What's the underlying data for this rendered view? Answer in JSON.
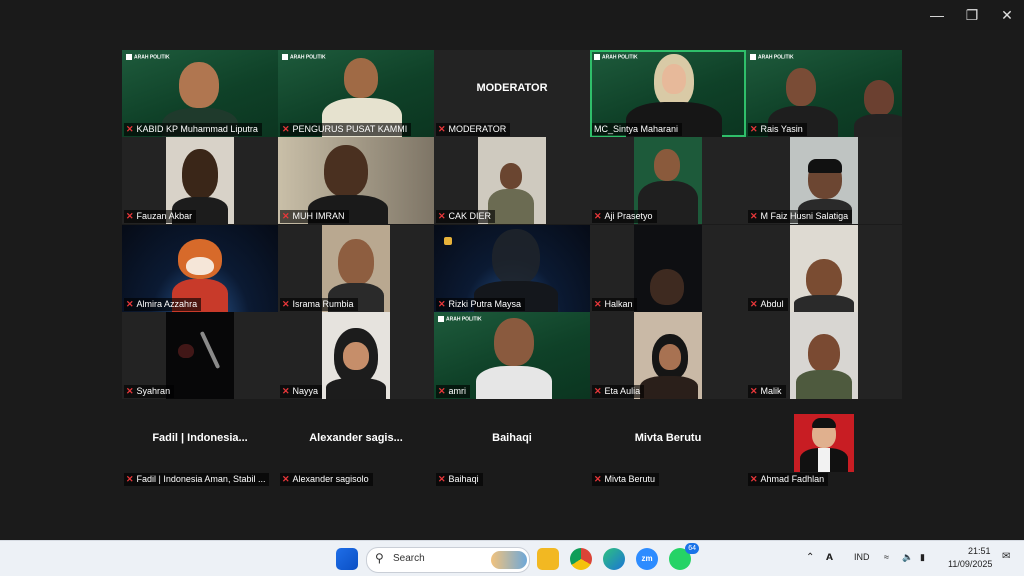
{
  "window": {
    "minimize_icon": "minimize-icon",
    "restore_icon": "restore-icon",
    "close_icon": "close-icon"
  },
  "colors": {
    "active_speaker": "#2fbf6a",
    "mute_icon": "#e8373a",
    "stage_bg": "#1b1b1b"
  },
  "participants": [
    {
      "name": "KABID KP Muhammad Liputra"
    },
    {
      "name": "PENGURUS PUSAT KAMMI"
    },
    {
      "name": "MODERATOR",
      "display": "MODERATOR"
    },
    {
      "name": "MC_Sintya Maharani"
    },
    {
      "name": "Rais Yasin"
    },
    {
      "name": "Fauzan Akbar"
    },
    {
      "name": "MUH IMRAN"
    },
    {
      "name": "CAK DIER"
    },
    {
      "name": "Aji Prasetyo"
    },
    {
      "name": "M Faiz Husni Salatiga"
    },
    {
      "name": "Almira Azzahra"
    },
    {
      "name": "Israma Rumbia"
    },
    {
      "name": "Rizki Putra Maysa"
    },
    {
      "name": "Halkan"
    },
    {
      "name": "Abdul"
    },
    {
      "name": "Syahran"
    },
    {
      "name": "Nayya"
    },
    {
      "name": "amri"
    },
    {
      "name": "Eta Aulia"
    },
    {
      "name": "Malik"
    },
    {
      "name": "Fadil | Indonesia Aman, Stabil ...",
      "display": "Fadil | Indonesia..."
    },
    {
      "name": "Alexander sagisolo",
      "display": "Alexander  sagis..."
    },
    {
      "name": "Baihaqi",
      "display": "Baihaqi"
    },
    {
      "name": "Mivta Berutu",
      "display": "Mivta Berutu"
    },
    {
      "name": "Ahmad Fadhlan"
    }
  ],
  "banner_logo": "ARAH POLITIK",
  "taskbar": {
    "search_placeholder": "Search",
    "zoom_label": "zm",
    "whatsapp_badge": "64",
    "language": "IND",
    "time": "21:51",
    "date": "11/09/2025"
  }
}
